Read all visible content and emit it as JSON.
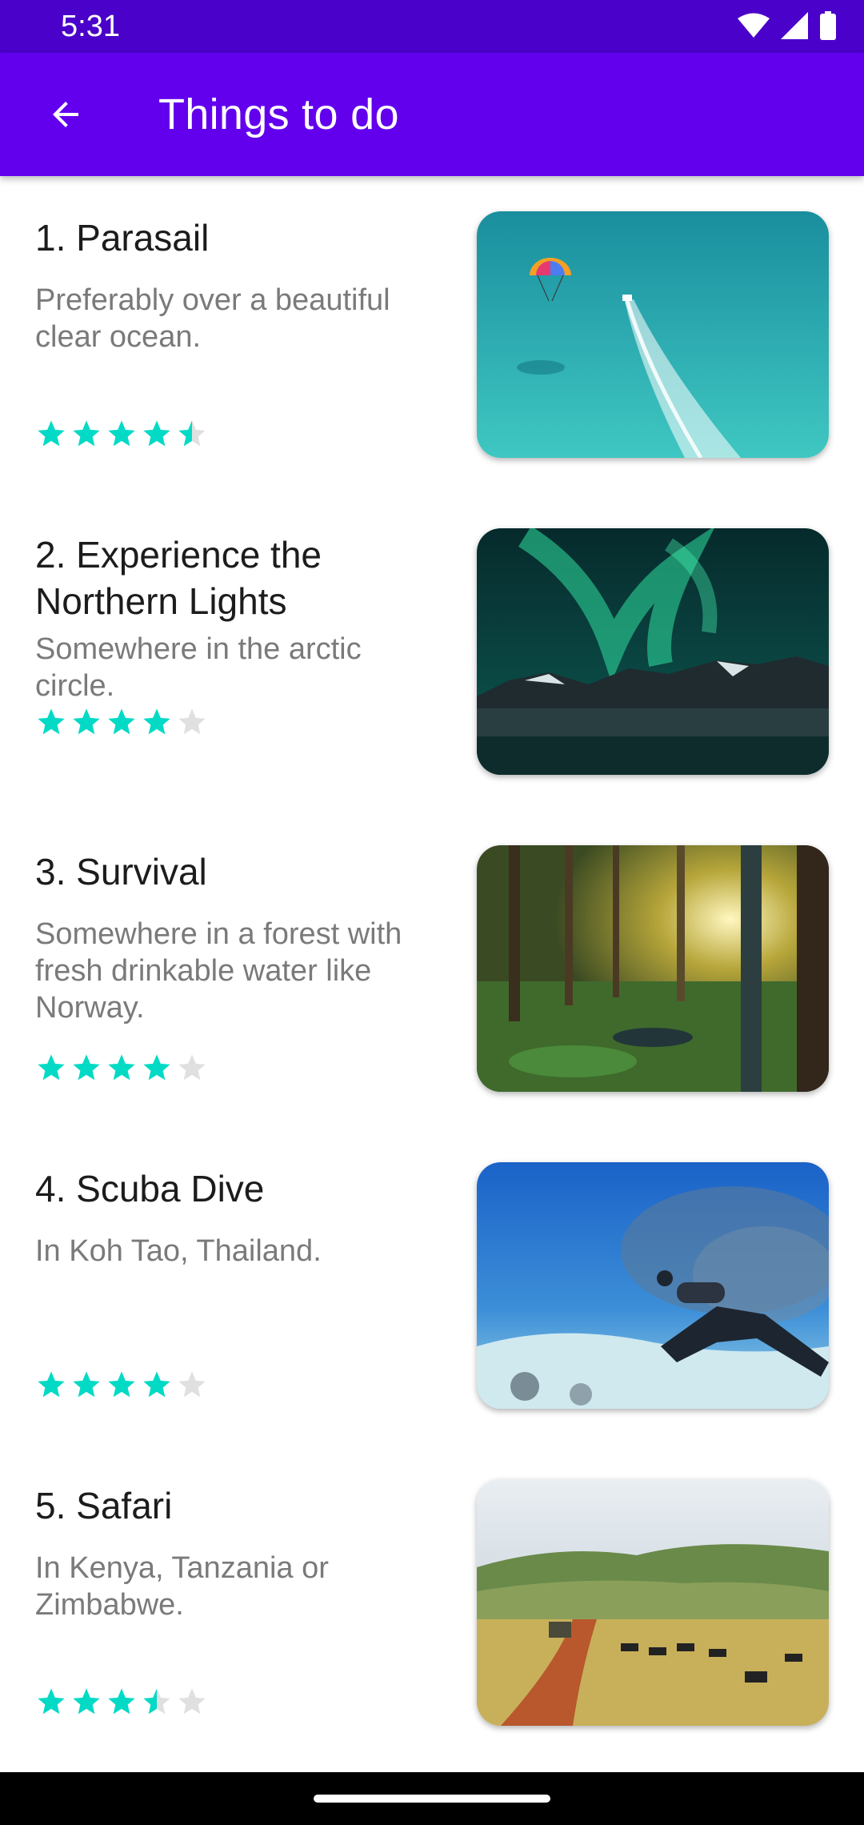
{
  "status_bar": {
    "time": "5:31"
  },
  "app_bar": {
    "title": "Things to do",
    "back_icon": "arrow-back-icon"
  },
  "colors": {
    "primary": "#6200ee",
    "status_bar": "#4a01c9",
    "star_filled": "#03dac5",
    "star_empty": "#e0e0e0"
  },
  "items": [
    {
      "title": "1. Parasail",
      "description": "Preferably over a beautiful clear ocean.",
      "rating": 4.5
    },
    {
      "title": "2. Experience the Northern Lights",
      "description": "Somewhere in the arctic circle.",
      "rating": 4
    },
    {
      "title": "3. Survival",
      "description": "Somewhere in a forest with fresh drinkable water like Norway.",
      "rating": 4
    },
    {
      "title": "4. Scuba Dive",
      "description": "In Koh Tao, Thailand.",
      "rating": 4
    },
    {
      "title": "5. Safari",
      "description": "In Kenya, Tanzania or Zimbabwe.",
      "rating": 3.5
    }
  ]
}
